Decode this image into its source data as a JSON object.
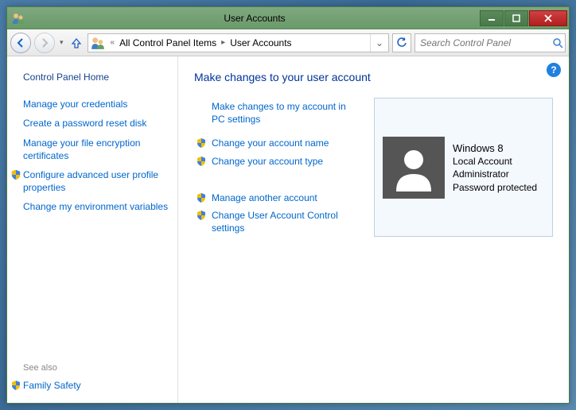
{
  "window": {
    "title": "User Accounts"
  },
  "nav": {
    "breadcrumb": {
      "item1": "All Control Panel Items",
      "item2": "User Accounts"
    },
    "search_placeholder": "Search Control Panel"
  },
  "sidebar": {
    "home": "Control Panel Home",
    "links": {
      "0": "Manage your credentials",
      "1": "Create a password reset disk",
      "2": "Manage your file encryption certificates",
      "3": "Configure advanced user profile properties",
      "4": "Change my environment variables"
    },
    "seealso_label": "See also",
    "seealso_link": "Family Safety"
  },
  "main": {
    "heading": "Make changes to your user account",
    "links": {
      "pc_settings": "Make changes to my account in PC settings",
      "change_name": "Change your account name",
      "change_type": "Change your account type",
      "manage_another": "Manage another account",
      "uac": "Change User Account Control settings"
    },
    "account": {
      "name": "Windows 8",
      "type": "Local Account",
      "role": "Administrator",
      "pw": "Password protected"
    }
  }
}
